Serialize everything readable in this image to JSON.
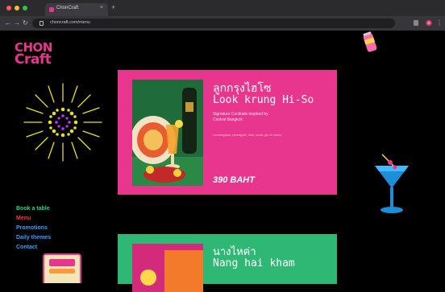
{
  "browser": {
    "tab_title": "ChonCraft",
    "tab_close": "×",
    "new_tab": "+",
    "url": "choncraft.com/menu",
    "back": "←",
    "forward": "→",
    "reload": "↻",
    "dot_colors": [
      "#ff5f57",
      "#febc2e",
      "#28c840"
    ]
  },
  "logo": {
    "line1": "CHON",
    "line2": "Craft"
  },
  "nav": [
    {
      "label": "Book a table",
      "color": "#2fd07a"
    },
    {
      "label": "Menu",
      "color": "#ff3b3b"
    },
    {
      "label": "Promotions",
      "color": "#3aa0ff"
    },
    {
      "label": "Daily themes",
      "color": "#3aa0ff"
    },
    {
      "label": "Contact",
      "color": "#3aa0ff"
    }
  ],
  "cards": [
    {
      "thai_name": "ลูกกรุงไฮโซ",
      "name": "Look krung Hi-So",
      "desc": "Signature Cocktails inspired by",
      "desc2": "Central Bangkok",
      "sub": "Lemongrass, pineapple, lime, soda, gin & honey",
      "price": "390 BAHT",
      "bg": "#e8368f"
    },
    {
      "thai_name": "นางไหค่า",
      "name": "Nang hai kham",
      "bg": "#2fb874"
    }
  ],
  "colors": {
    "accent_pink": "#e8368f",
    "accent_green": "#2fb874",
    "starburst": "#e8e020",
    "starburst_dots": "#b83cff"
  },
  "icons": [
    "lock-icon",
    "starburst-icon",
    "cocktail-glass-icon",
    "drink-can-icon",
    "sticker-icon"
  ]
}
